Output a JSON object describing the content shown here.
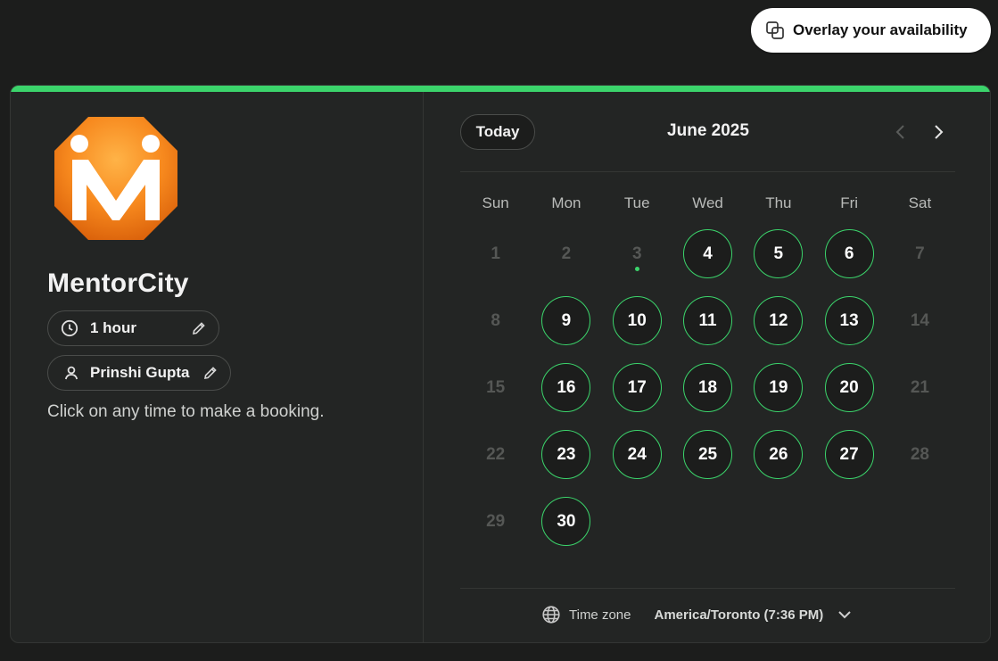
{
  "header": {
    "overlay_label": "Overlay your availability",
    "overlay_icon": "overlay-squares-icon"
  },
  "profile": {
    "logo_icon": "mentorcity-logo",
    "name": "MentorCity",
    "duration": "1 hour",
    "host": "Prinshi Gupta",
    "hint": "Click on any time to make a booking."
  },
  "calendar": {
    "today_label": "Today",
    "month_label": "June 2025",
    "weekdays": [
      "Sun",
      "Mon",
      "Tue",
      "Wed",
      "Thu",
      "Fri",
      "Sat"
    ],
    "weeks": [
      [
        {
          "day": "1",
          "available": false
        },
        {
          "day": "2",
          "available": false
        },
        {
          "day": "3",
          "available": false,
          "today": true
        },
        {
          "day": "4",
          "available": true
        },
        {
          "day": "5",
          "available": true
        },
        {
          "day": "6",
          "available": true
        },
        {
          "day": "7",
          "available": false
        }
      ],
      [
        {
          "day": "8",
          "available": false
        },
        {
          "day": "9",
          "available": true
        },
        {
          "day": "10",
          "available": true
        },
        {
          "day": "11",
          "available": true
        },
        {
          "day": "12",
          "available": true
        },
        {
          "day": "13",
          "available": true
        },
        {
          "day": "14",
          "available": false
        }
      ],
      [
        {
          "day": "15",
          "available": false
        },
        {
          "day": "16",
          "available": true
        },
        {
          "day": "17",
          "available": true
        },
        {
          "day": "18",
          "available": true
        },
        {
          "day": "19",
          "available": true
        },
        {
          "day": "20",
          "available": true
        },
        {
          "day": "21",
          "available": false
        }
      ],
      [
        {
          "day": "22",
          "available": false
        },
        {
          "day": "23",
          "available": true
        },
        {
          "day": "24",
          "available": true
        },
        {
          "day": "25",
          "available": true
        },
        {
          "day": "26",
          "available": true
        },
        {
          "day": "27",
          "available": true
        },
        {
          "day": "28",
          "available": false
        }
      ],
      [
        {
          "day": "29",
          "available": false
        },
        {
          "day": "30",
          "available": true
        },
        null,
        null,
        null,
        null,
        null
      ]
    ]
  },
  "timezone": {
    "label": "Time zone",
    "value": "America/Toronto (7:36 PM)"
  },
  "colors": {
    "accent": "#3bd46b",
    "background": "#1c1d1c",
    "card": "#232524"
  }
}
